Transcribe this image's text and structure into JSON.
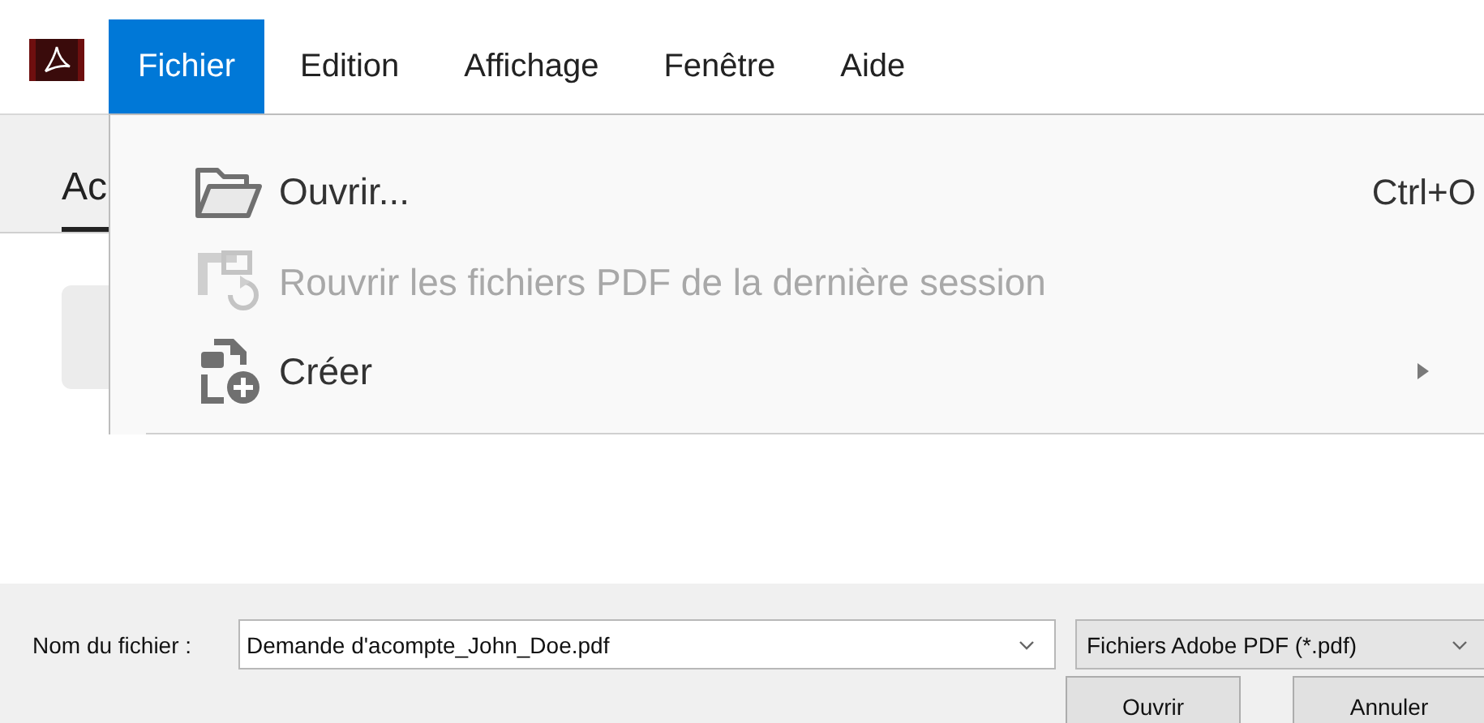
{
  "menubar": {
    "items": [
      {
        "label": "Fichier",
        "selected": true
      },
      {
        "label": "Edition",
        "selected": false
      },
      {
        "label": "Affichage",
        "selected": false
      },
      {
        "label": "Fenêtre",
        "selected": false
      },
      {
        "label": "Aide",
        "selected": false
      }
    ]
  },
  "background_tab": {
    "label": "Ac",
    "selected": true
  },
  "file_menu": {
    "items": [
      {
        "kind": "folder",
        "label": "Ouvrir...",
        "shortcut": "Ctrl+O",
        "disabled": false,
        "submenu": false
      },
      {
        "kind": "reopen",
        "label": "Rouvrir les fichiers PDF de la dernière session",
        "disabled": true,
        "submenu": false
      },
      {
        "kind": "create",
        "label": "Créer",
        "disabled": false,
        "submenu": true
      }
    ]
  },
  "save_dialog": {
    "filename_label": "Nom du fichier :",
    "filename_value": "Demande d'acompte_John_Doe.pdf",
    "file_type": "Fichiers Adobe PDF (*.pdf)",
    "buttons": [
      "Ouvrir",
      "Annuler"
    ]
  }
}
